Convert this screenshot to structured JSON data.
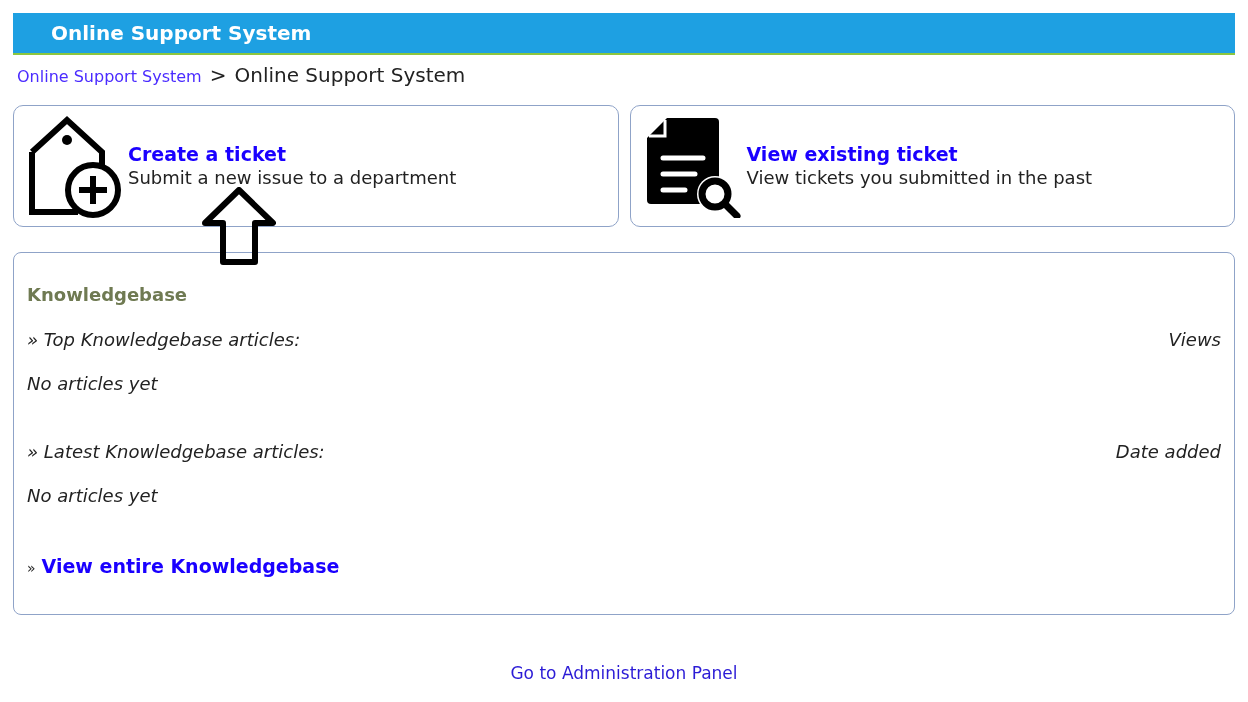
{
  "header": {
    "title": "Online Support System"
  },
  "breadcrumb": {
    "link": "Online Support System",
    "separator": ">",
    "current": "Online Support System"
  },
  "cards": [
    {
      "kind": "create",
      "title": "Create a ticket",
      "description": "Submit a new issue to a department"
    },
    {
      "kind": "view",
      "title": "View existing ticket",
      "description": "View tickets you submitted in the past"
    }
  ],
  "knowledgebase": {
    "title": "Knowledgebase",
    "sections": [
      {
        "heading": "» Top Knowledgebase articles:",
        "column": "Views",
        "empty": "No articles yet"
      },
      {
        "heading": "» Latest Knowledgebase articles:",
        "column": "Date added",
        "empty": "No articles yet"
      }
    ],
    "link_bullet": "»",
    "link": "View entire Knowledgebase"
  },
  "footer": {
    "link": "Go to Administration Panel"
  }
}
